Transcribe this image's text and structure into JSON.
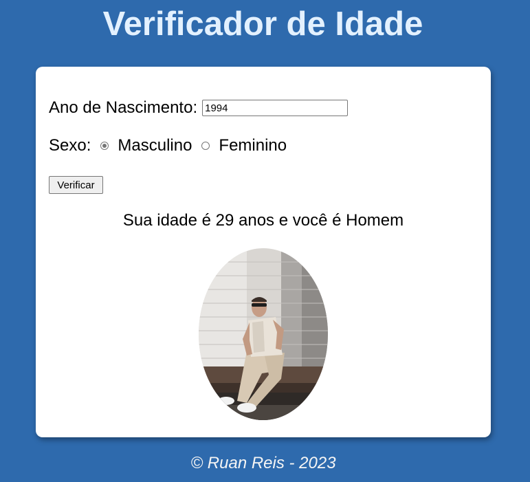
{
  "header": {
    "title": "Verificador de Idade"
  },
  "form": {
    "birth_year_label": "Ano de Nascimento:",
    "birth_year_value": "1994",
    "sex_label": "Sexo:",
    "sex_options": [
      {
        "label": "Masculino",
        "checked": true
      },
      {
        "label": "Feminino",
        "checked": false
      }
    ],
    "verify_button": "Verificar"
  },
  "result": {
    "text": "Sua idade é 29 anos e você é Homem"
  },
  "footer": {
    "text": "© Ruan Reis - 2023"
  },
  "colors": {
    "background": "#2e6aad",
    "title": "#e3f1ff",
    "card": "#ffffff"
  }
}
